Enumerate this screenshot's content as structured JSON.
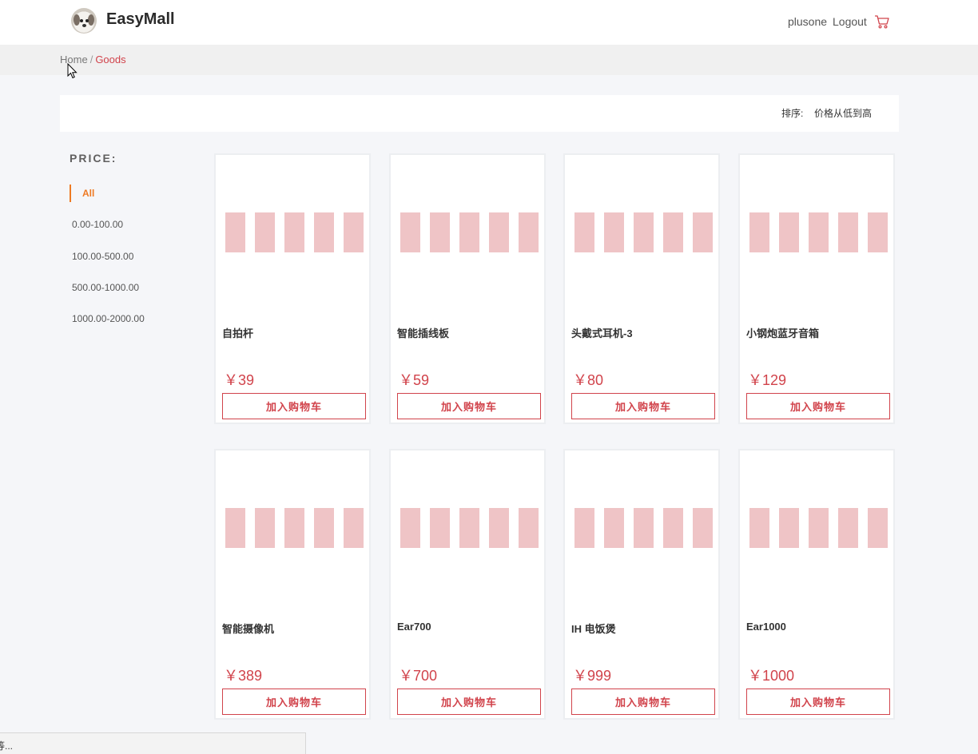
{
  "header": {
    "brand": "EasyMall",
    "user": "plusone",
    "logout": "Logout"
  },
  "breadcrumb": {
    "home": "Home",
    "separator": "/",
    "current": "Goods"
  },
  "sort": {
    "label": "排序:",
    "option": "价格从低到高"
  },
  "filter": {
    "title": "PRICE:",
    "items": [
      "All",
      "0.00-100.00",
      "100.00-500.00",
      "500.00-1000.00",
      "1000.00-2000.00"
    ],
    "active": "All"
  },
  "products": [
    {
      "name": "自拍杆",
      "price": "￥39"
    },
    {
      "name": "智能插线板",
      "price": "￥59"
    },
    {
      "name": "头戴式耳机-3",
      "price": "￥80"
    },
    {
      "name": "小钢炮蓝牙音箱",
      "price": "￥129"
    },
    {
      "name": "智能摄像机",
      "price": "￥389"
    },
    {
      "name": "Ear700",
      "price": "￥700"
    },
    {
      "name": "IH 电饭煲",
      "price": "￥999"
    },
    {
      "name": "Ear1000",
      "price": "￥1000"
    }
  ],
  "add_to_cart_label": "加入购物车",
  "status_bar": "等...",
  "colors": {
    "accent": "#d1434b",
    "filter_active": "#ee7a23",
    "placeholder": "#efc4c6"
  }
}
